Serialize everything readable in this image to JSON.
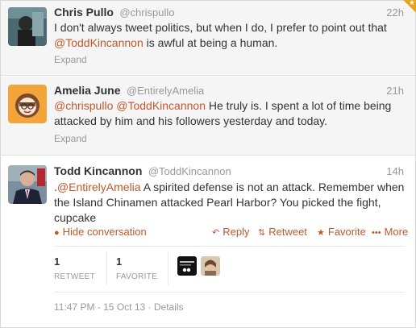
{
  "tweets": [
    {
      "fullname": "Chris Pullo",
      "username": "@chrispullo",
      "time": "22h",
      "text_line1": "I don't always tweet politics, but when I do, I prefer to point out that",
      "text_mention": "@ToddKincannon",
      "text_rest": " is awful at being a human.",
      "expand": "Expand"
    },
    {
      "fullname": "Amelia June",
      "username": "@EntirelyAmelia",
      "time": "21h",
      "mention1": "@chrispullo",
      "mention2": "@ToddKincannon",
      "text_rest": " He truly is. I spent a lot of time being attacked by him and his followers yesterday and today.",
      "expand": "Expand"
    },
    {
      "fullname": "Todd Kincannon",
      "username": "@ToddKincannon",
      "time": "14h",
      "text_prefix": ".",
      "mention": "@EntirelyAmelia",
      "text_rest": " A spirited defense is not an attack. Remember when the Island Chinamen attacked Pearl Harbor? You picked the fight, cupcake"
    }
  ],
  "actions": {
    "hide": "Hide conversation",
    "reply": "Reply",
    "retweet": "Retweet",
    "favorite": "Favorite",
    "more": "More"
  },
  "stats": {
    "retweets": "1",
    "retweets_label": "RETWEET",
    "favorites": "1",
    "favorites_label": "FAVORITE"
  },
  "footer": {
    "timestamp": "11:47 PM - 15 Oct 13",
    "separator": "·",
    "details": "Details"
  },
  "colors": {
    "link": "#c0582a",
    "muted": "#999999",
    "corner_badge": "#e8a317"
  },
  "icons": [
    "hide-conversation-icon",
    "reply-arrow-icon",
    "retweet-icon",
    "favorite-star-icon",
    "more-dots-icon",
    "star-badge-icon"
  ]
}
